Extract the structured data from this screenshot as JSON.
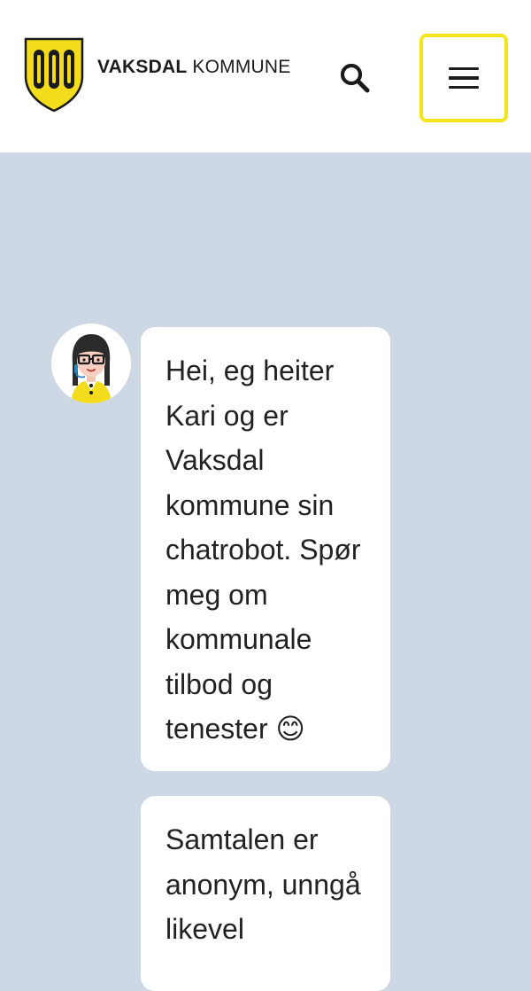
{
  "header": {
    "brand_bold": "VAKSDAL",
    "brand_regular": "KOMMUNE",
    "coat_of_arms_icon": "vaksdal-coat-of-arms-icon",
    "search_icon": "search-icon",
    "menu_icon": "hamburger-menu-icon",
    "menu_border_color": "#f4e41c"
  },
  "chat": {
    "background_color": "#cdd8e4",
    "avatar_icon": "chatbot-kari-avatar",
    "messages": [
      {
        "text": "Hei, eg heiter Kari og er Vaksdal kommune sin chatrobot. Spør meg om kommunale tilbod og tenester 😊"
      },
      {
        "text": "Samtalen er anonym, unngå likevel"
      }
    ]
  }
}
